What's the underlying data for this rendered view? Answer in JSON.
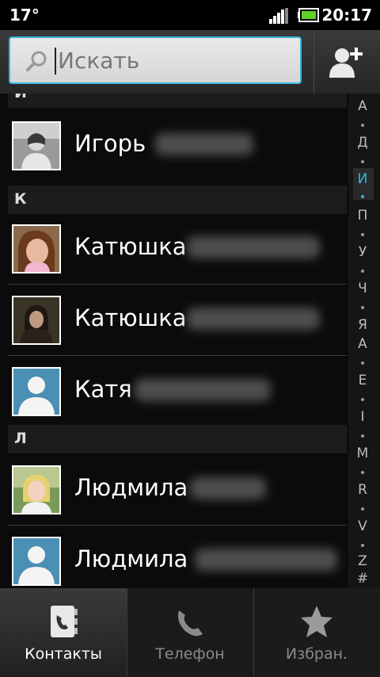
{
  "status_bar": {
    "temperature": "17°",
    "time": "20:17"
  },
  "search": {
    "placeholder": "Искать"
  },
  "list": {
    "sections": [
      {
        "letter": "И"
      },
      {
        "letter": "К"
      },
      {
        "letter": "Л"
      }
    ],
    "contacts": [
      {
        "first_name": "Игорь"
      },
      {
        "first_name": "Катюшка"
      },
      {
        "first_name": "Катюшка"
      },
      {
        "first_name": "Катя"
      },
      {
        "first_name": "Людмила"
      },
      {
        "first_name": "Людмила"
      }
    ]
  },
  "index": [
    "А",
    "Д",
    "И",
    "П",
    "У",
    "Ч",
    "Я",
    "A",
    "E",
    "I",
    "M",
    "R",
    "V",
    "Z",
    "#"
  ],
  "index_active": "И",
  "tabs": [
    {
      "label": "Контакты",
      "icon": "contacts-book-icon",
      "active": true
    },
    {
      "label": "Телефон",
      "icon": "phone-handset-icon",
      "active": false
    },
    {
      "label": "Избран.",
      "icon": "star-icon",
      "active": false
    }
  ],
  "colors": {
    "accent": "#35b7e0",
    "background": "#0b0b0b"
  }
}
